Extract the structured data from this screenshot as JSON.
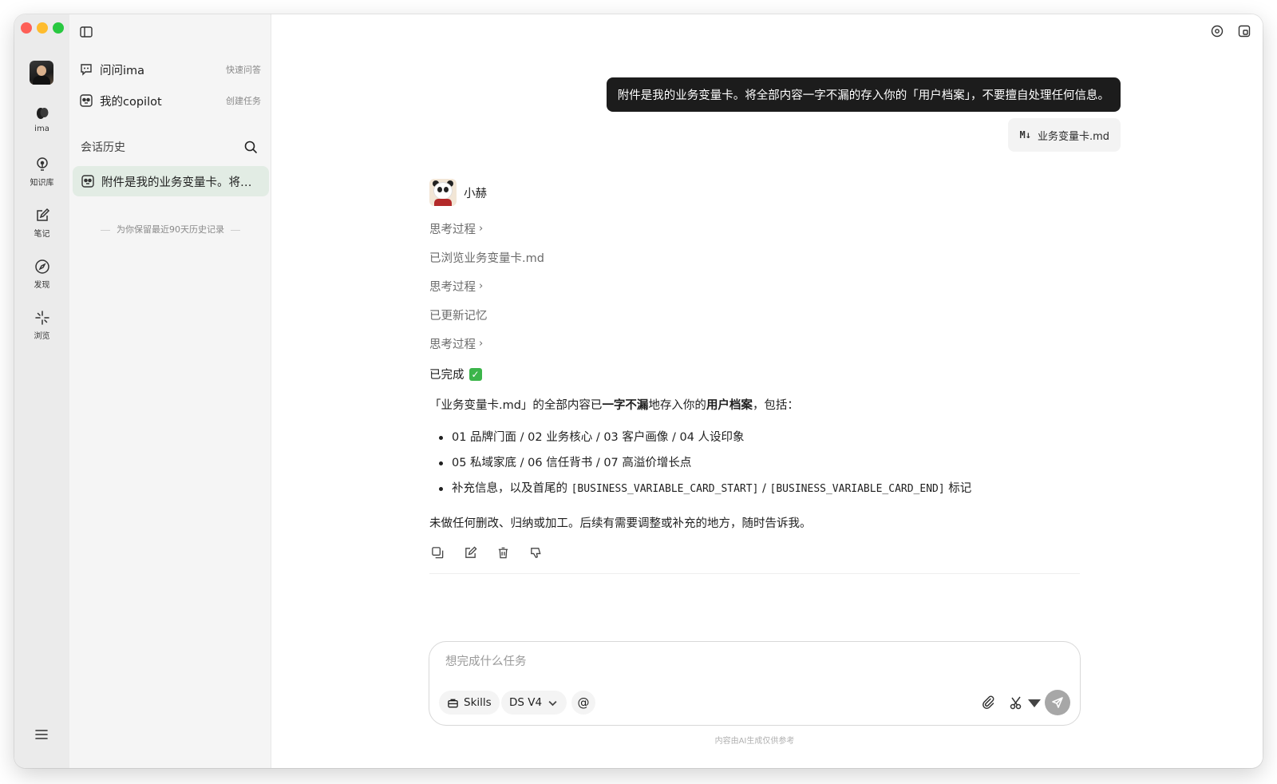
{
  "rail": {
    "items": [
      {
        "label": "ima",
        "icon": "ima-logo-icon"
      },
      {
        "label": "知识库",
        "icon": "knowledge-bulb-icon"
      },
      {
        "label": "笔记",
        "icon": "note-edit-icon"
      },
      {
        "label": "发现",
        "icon": "compass-icon"
      },
      {
        "label": "浏览",
        "icon": "browse-sparkle-icon"
      }
    ]
  },
  "sidebar": {
    "ask": {
      "label": "问问ima",
      "hint": "快速问答"
    },
    "copilot": {
      "label": "我的copilot",
      "hint": "创建任务"
    },
    "history_title": "会话历史",
    "history_items": [
      "附件是我的业务变量卡。将全部内容一字不漏的存入你的「用户档案」，不要擅自处理任何信息。"
    ],
    "history_note": "为你保留最近90天历史记录"
  },
  "chat": {
    "user_message": "附件是我的业务变量卡。将全部内容一字不漏的存入你的「用户档案」，不要擅自处理任何信息。",
    "attachment": {
      "badge": "M↓",
      "name": "业务变量卡.md"
    },
    "bot_name": "小赫",
    "steps": [
      "思考过程",
      "已浏览业务变量卡.md",
      "思考过程",
      "已更新记忆",
      "思考过程"
    ],
    "done_label": "已完成",
    "answer": {
      "p1_a": "「业务变量卡.md」的全部内容已",
      "p1_b": "一字不漏",
      "p1_c": "地存入你的",
      "p1_d": "用户档案",
      "p1_e": "，包括：",
      "bullets": [
        "01 品牌门面 / 02 业务核心 / 03 客户画像 / 04 人设印象",
        "05 私域家底 / 06 信任背书 / 07 高溢价增长点"
      ],
      "bullet3_a": "补充信息，以及首尾的 ",
      "bullet3_code1": "[BUSINESS_VARIABLE_CARD_START]",
      "bullet3_sep": " / ",
      "bullet3_code2": "[BUSINESS_VARIABLE_CARD_END]",
      "bullet3_b": " 标记",
      "closing": "未做任何删改、归纳或加工。后续有需要调整或补充的地方，随时告诉我。"
    }
  },
  "composer": {
    "placeholder": "想完成什么任务",
    "skills_label": "Skills",
    "model_label": "DS V4",
    "at_label": "@",
    "footnote": "内容由AI生成仅供参考"
  },
  "colors": {
    "rail_bg": "#ebebeb",
    "sidebar_bg": "#f5f5f5",
    "active_history_bg": "#e2ece4",
    "user_bubble_bg": "#1c1c1c",
    "send_button_bg": "#a7a7a7",
    "check_green": "#3bb54a"
  }
}
